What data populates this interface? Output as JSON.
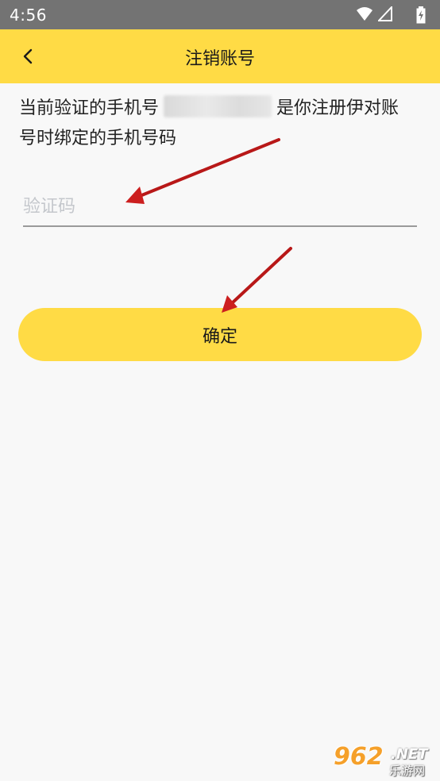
{
  "status_bar": {
    "time": "4:56"
  },
  "header": {
    "title": "注销账号",
    "back_icon": "chevron-left-icon"
  },
  "description": {
    "prefix": "当前验证的手机号",
    "suffix": "是你注册伊对账号时绑定的手机号码"
  },
  "code_input": {
    "placeholder": "验证码",
    "value": ""
  },
  "confirm_button": {
    "label": "确定"
  },
  "watermark": {
    "number": "962",
    "domain": ".NET",
    "name": "乐游网"
  },
  "colors": {
    "accent": "#ffdb45",
    "status_bar": "#737373",
    "background": "#f8f8f8",
    "annotation_arrow": "#cc1f1f"
  }
}
